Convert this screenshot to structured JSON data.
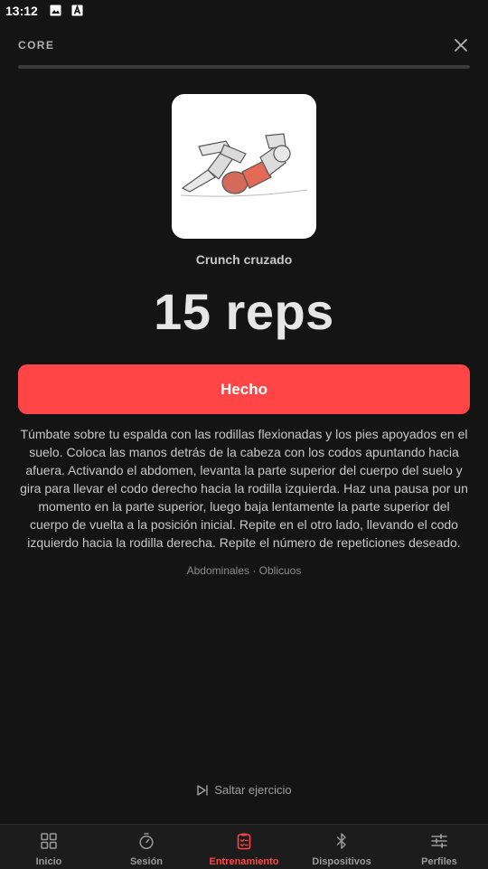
{
  "status_bar": {
    "time": "13:12"
  },
  "header": {
    "title": "CORE",
    "progress": 0.0
  },
  "exercise": {
    "name": "Crunch cruzado",
    "reps": "15 reps",
    "done_label": "Hecho",
    "description": "Túmbate sobre tu espalda con las rodillas flexionadas y los pies apoyados en el suelo. Coloca las manos detrás de la cabeza con los codos apuntando hacia afuera. Activando el abdomen, levanta la parte superior del cuerpo del suelo y gira para llevar el codo derecho hacia la rodilla izquierda. Haz una pausa por un momento en la parte superior, luego baja lentamente la parte superior del cuerpo de vuelta a la posición inicial. Repite en el otro lado, llevando el codo izquierdo hacia la rodilla derecha. Repite el número de repeticiones deseado.",
    "muscles": "Abdominales · Oblicuos"
  },
  "skip_label": "Saltar ejercicio",
  "nav": {
    "items": [
      {
        "label": "Inicio",
        "icon": "grid-icon"
      },
      {
        "label": "Sesión",
        "icon": "stopwatch-icon"
      },
      {
        "label": "Entrenamiento",
        "icon": "clipboard-icon",
        "active": true
      },
      {
        "label": "Dispositivos",
        "icon": "bluetooth-icon"
      },
      {
        "label": "Perfiles",
        "icon": "sliders-icon"
      }
    ]
  },
  "colors": {
    "accent": "#ff4545",
    "background": "#141414",
    "nav_background": "#1c1c1c"
  }
}
